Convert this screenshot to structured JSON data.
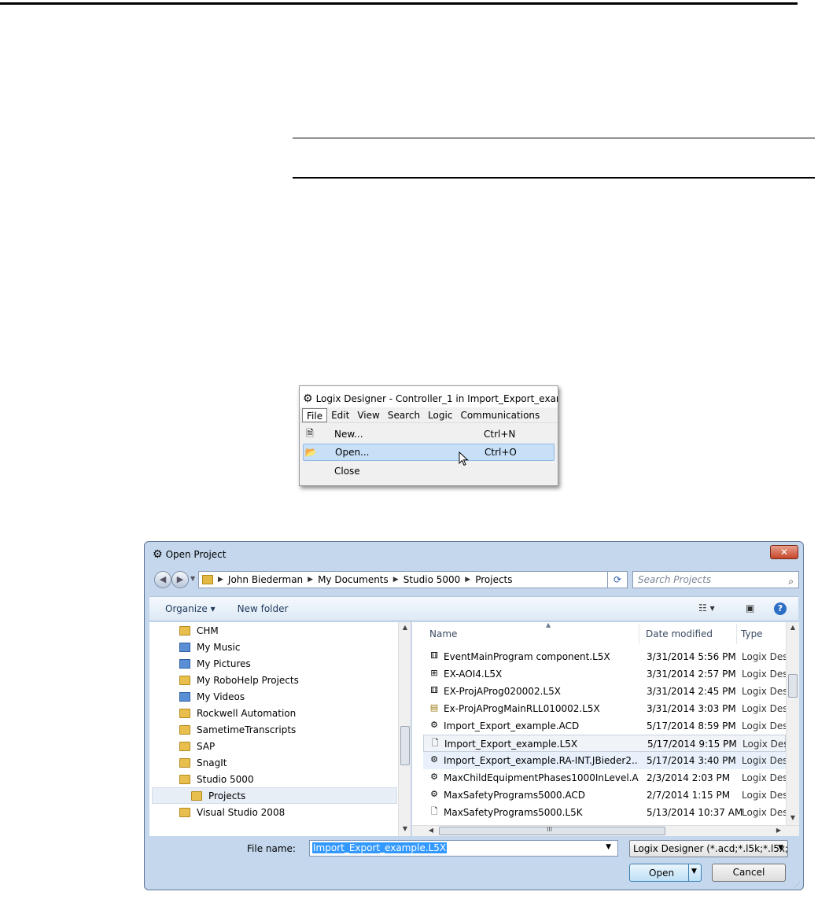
{
  "menu_screenshot": {
    "window_title": "Logix Designer - Controller_1 in Import_Export_examp",
    "menubar": [
      "File",
      "Edit",
      "View",
      "Search",
      "Logic",
      "Communications"
    ],
    "items": [
      {
        "icon": "new-file-icon",
        "label": "New...",
        "shortcut": "Ctrl+N"
      },
      {
        "icon": "open-folder-icon",
        "label": "Open...",
        "shortcut": "Ctrl+O"
      },
      {
        "icon": "",
        "label": "Close",
        "shortcut": ""
      }
    ]
  },
  "dialog": {
    "title": "Open Project",
    "close_glyph": "✕",
    "breadcrumb": [
      "John Biederman",
      "My Documents",
      "Studio 5000",
      "Projects"
    ],
    "search_placeholder": "Search Projects",
    "toolbar": {
      "organize": "Organize ▾",
      "new_folder": "New folder"
    },
    "nav_items": [
      {
        "label": "CHM",
        "icon": "folder"
      },
      {
        "label": "My Music",
        "icon": "special"
      },
      {
        "label": "My Pictures",
        "icon": "special"
      },
      {
        "label": "My RoboHelp Projects",
        "icon": "folder"
      },
      {
        "label": "My Videos",
        "icon": "special"
      },
      {
        "label": "Rockwell Automation",
        "icon": "folder"
      },
      {
        "label": "SametimeTranscripts",
        "icon": "folder"
      },
      {
        "label": "SAP",
        "icon": "folder"
      },
      {
        "label": "SnagIt",
        "icon": "folder"
      },
      {
        "label": "Studio 5000",
        "icon": "folder"
      },
      {
        "label": "Projects",
        "icon": "folder",
        "selected": true
      },
      {
        "label": "Visual Studio 2008",
        "icon": "folder"
      }
    ],
    "columns": [
      "Name",
      "Date modified",
      "Type"
    ],
    "files": [
      {
        "name": "EventMainProgram component.L5X",
        "date": "3/31/2014 5:56 PM",
        "type": "Logix Des",
        "icon": "program-icon"
      },
      {
        "name": "EX-AOI4.L5X",
        "date": "3/31/2014 2:57 PM",
        "type": "Logix Des",
        "icon": "aoi-icon"
      },
      {
        "name": "EX-ProjAProg020002.L5X",
        "date": "3/31/2014 2:45 PM",
        "type": "Logix Des",
        "icon": "program-icon"
      },
      {
        "name": "Ex-ProjAProgMainRLL010002.L5X",
        "date": "3/31/2014 3:03 PM",
        "type": "Logix Des",
        "icon": "routine-icon"
      },
      {
        "name": "Import_Export_example.ACD",
        "date": "5/17/2014 8:59 PM",
        "type": "Logix Des",
        "icon": "logix-icon"
      },
      {
        "name": "Import_Export_example.L5X",
        "date": "5/17/2014 9:15 PM",
        "type": "Logix Des",
        "icon": "document-icon",
        "selected": true
      },
      {
        "name": "Import_Export_example.RA-INT.JBieder2....",
        "date": "5/17/2014 3:40 PM",
        "type": "Logix Des",
        "icon": "logix-icon",
        "hover": true
      },
      {
        "name": "MaxChildEquipmentPhases1000InLevel.A...",
        "date": "2/3/2014 2:03 PM",
        "type": "Logix Des",
        "icon": "logix-icon"
      },
      {
        "name": "MaxSafetyPrograms5000.ACD",
        "date": "2/7/2014 1:15 PM",
        "type": "Logix Des",
        "icon": "logix-icon"
      },
      {
        "name": "MaxSafetyPrograms5000.L5K",
        "date": "5/13/2014 10:37 AM",
        "type": "Logix Des",
        "icon": "document-icon"
      }
    ],
    "hscroll_glyph": "III",
    "file_name_label": "File name:",
    "file_name_value": "Import_Export_example.L5X",
    "file_type": "Logix Designer (*.acd;*.l5k;*.l5x;",
    "open_label": "Open",
    "cancel_label": "Cancel"
  }
}
